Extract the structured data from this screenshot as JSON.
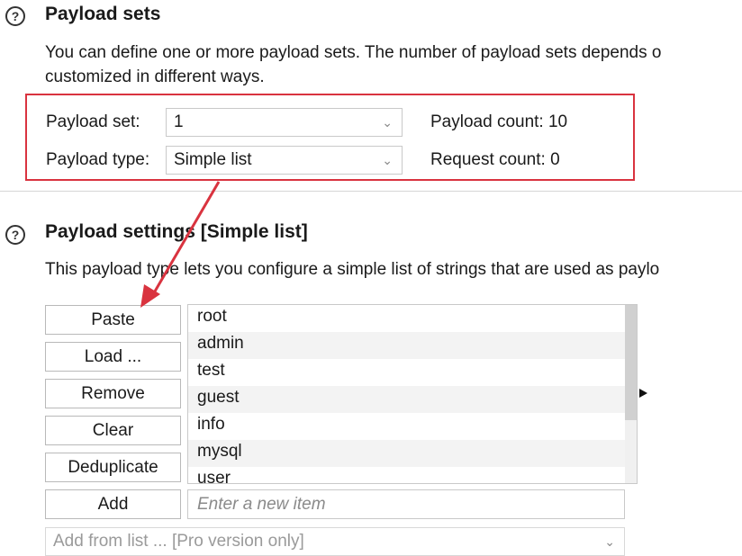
{
  "payload_sets": {
    "title": "Payload sets",
    "description_line1": "You can define one or more payload sets. The number of payload sets depends o",
    "description_line2": "customized in different ways.",
    "payload_set_label": "Payload set:",
    "payload_set_value": "1",
    "payload_type_label": "Payload type:",
    "payload_type_value": "Simple list",
    "payload_count": "Payload count: 10",
    "request_count": "Request count: 0"
  },
  "payload_settings": {
    "title": "Payload settings [Simple list]",
    "description": "This payload type lets you configure a simple list of strings that are used as paylo",
    "buttons": {
      "paste": "Paste",
      "load": "Load ...",
      "remove": "Remove",
      "clear": "Clear",
      "deduplicate": "Deduplicate",
      "add": "Add"
    },
    "items": [
      "root",
      "admin",
      "test",
      "guest",
      "info",
      "mysql",
      "user"
    ],
    "new_item_placeholder": "Enter a new item",
    "add_from_list": "Add from list ... [Pro version only]"
  },
  "icons": {
    "help": "help-circle-icon",
    "dropdown": "chevron-down-icon",
    "annotation": "red-arrow-annotation"
  },
  "colors": {
    "annotation_red": "#d9333f"
  }
}
